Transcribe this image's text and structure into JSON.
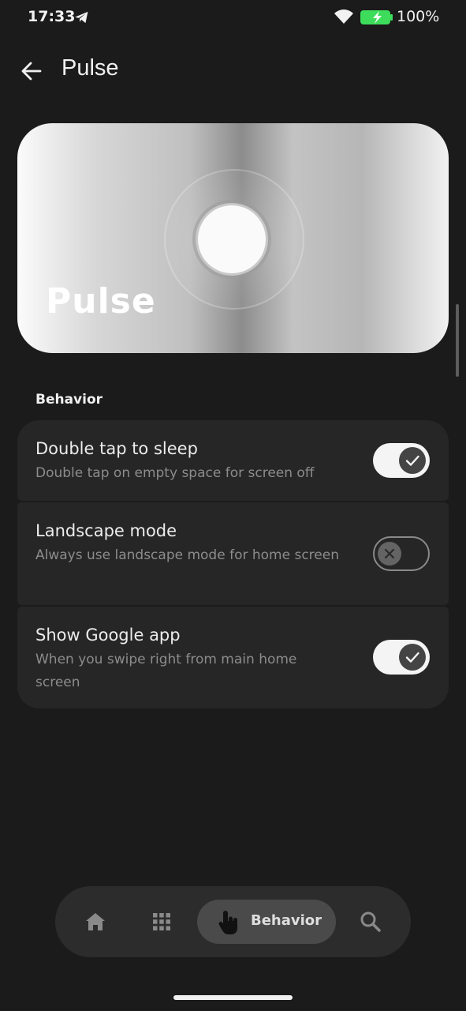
{
  "status_bar": {
    "time": "17:33",
    "battery_percent": "100%",
    "icons": [
      "telegram-icon",
      "wifi-icon",
      "battery-charging-icon"
    ]
  },
  "header": {
    "title": "Pulse",
    "back_icon": "arrow-left-icon"
  },
  "hero": {
    "title": "Pulse"
  },
  "section": {
    "title": "Behavior"
  },
  "settings": [
    {
      "title": "Double tap to sleep",
      "description": "Double tap on empty space for screen off",
      "enabled": true
    },
    {
      "title": "Landscape mode",
      "description": "Always use landscape mode for home screen",
      "enabled": false
    },
    {
      "title": "Show Google app",
      "description": "When you swipe right from main home screen",
      "enabled": true
    }
  ],
  "bottom_nav": {
    "items": [
      {
        "icon": "home-icon"
      },
      {
        "icon": "apps-grid-icon"
      },
      {
        "icon": "touch-icon",
        "label": "Behavior",
        "active": true
      },
      {
        "icon": "search-icon"
      }
    ]
  },
  "colors": {
    "background": "#1b1b1b",
    "card": "#262626",
    "toggle_on": "#f4f4f4",
    "battery": "#3ddc5a"
  }
}
